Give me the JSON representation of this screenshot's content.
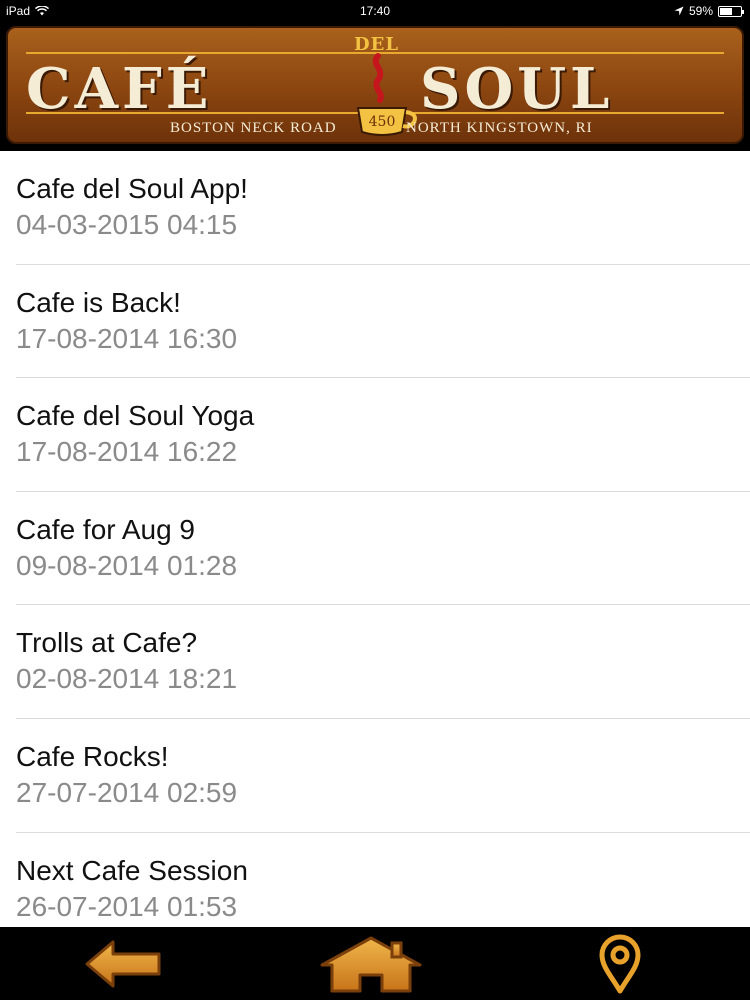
{
  "status_bar": {
    "device": "iPad",
    "time": "17:40",
    "battery": "59%",
    "battery_level": 0.59
  },
  "header": {
    "logo_left": "CAFÉ",
    "logo_del": "DEL",
    "logo_right": "SOUL",
    "cup_number": "450",
    "address_left": "Boston Neck Road",
    "address_right": "North Kingstown, RI"
  },
  "posts": [
    {
      "title": "Cafe del Soul App!",
      "date": "04-03-2015 04:15"
    },
    {
      "title": "Cafe is Back!",
      "date": "17-08-2014 16:30"
    },
    {
      "title": "Cafe del Soul Yoga",
      "date": "17-08-2014 16:22"
    },
    {
      "title": "Cafe for Aug 9",
      "date": "09-08-2014 01:28"
    },
    {
      "title": "Trolls at Cafe?",
      "date": "02-08-2014 18:21"
    },
    {
      "title": "Cafe Rocks!",
      "date": "27-07-2014 02:59"
    },
    {
      "title": "Next Cafe Session",
      "date": "26-07-2014 01:53"
    }
  ],
  "toolbar": {
    "back_icon": "back-arrow-icon",
    "home_icon": "home-icon",
    "map_icon": "map-pin-icon"
  },
  "colors": {
    "accent_orange": "#e7a92f",
    "banner_brown": "#8a4510",
    "date_gray": "#8a8a8a"
  }
}
